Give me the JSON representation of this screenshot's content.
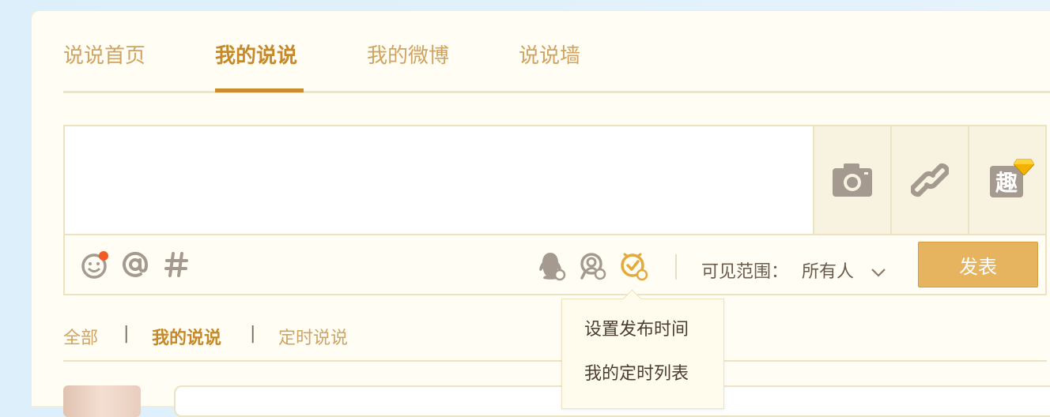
{
  "tabs": [
    {
      "label": "说说首页"
    },
    {
      "label": "我的说说"
    },
    {
      "label": "我的微博"
    },
    {
      "label": "说说墙"
    }
  ],
  "composer": {
    "text_value": "",
    "fun_label": "趣"
  },
  "toolbar": {
    "scope_label": "可见范围：",
    "scope_value": "所有人",
    "publish_label": "发表"
  },
  "timer_menu": {
    "items": [
      {
        "label": "设置发布时间"
      },
      {
        "label": "我的定时列表"
      }
    ]
  },
  "filters": {
    "items": [
      {
        "label": "全部"
      },
      {
        "label": "我的说说"
      },
      {
        "label": "定时说说"
      }
    ],
    "separator": "|"
  },
  "colors": {
    "accent": "#c98d2d",
    "tab_inactive": "#cfa461",
    "publish_bg": "#e6b45f",
    "notify_dot": "#f15a24",
    "icon_gray": "#a49a8f"
  }
}
